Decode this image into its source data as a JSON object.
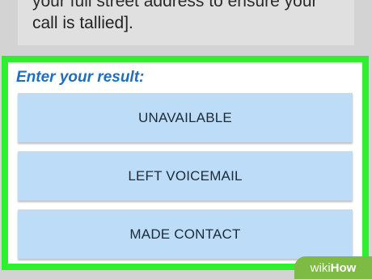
{
  "top_card": {
    "line1": "your full street address to ensure your",
    "line2": "call is tallied]."
  },
  "prompt": "Enter your result:",
  "buttons": [
    {
      "label": "UNAVAILABLE"
    },
    {
      "label": "LEFT VOICEMAIL"
    },
    {
      "label": "MADE CONTACT"
    }
  ],
  "watermark": {
    "part1": "wiki",
    "part2": "How"
  },
  "colors": {
    "highlight": "#2ff02f",
    "prompt_text": "#1f6fc0",
    "button_bg": "#bcdcf7",
    "watermark_bg": "#7dbb45"
  }
}
